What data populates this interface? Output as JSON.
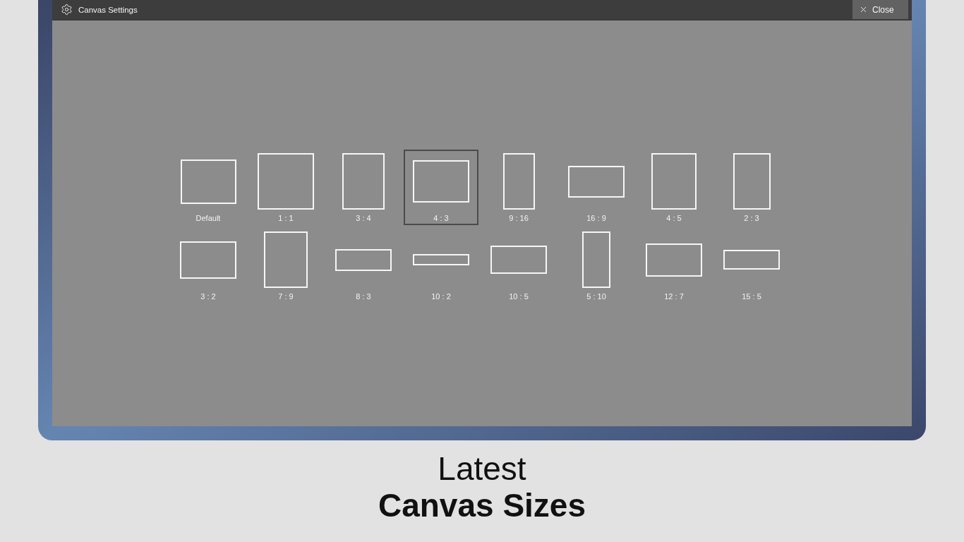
{
  "window": {
    "title": "Canvas Settings",
    "close_button": "Close"
  },
  "presets": [
    {
      "label": "Default",
      "selected": false
    },
    {
      "label": "1 : 1",
      "selected": false
    },
    {
      "label": "3 : 4",
      "selected": false
    },
    {
      "label": "4 : 3",
      "selected": true
    },
    {
      "label": "9 : 16",
      "selected": false
    },
    {
      "label": "16 : 9",
      "selected": false
    },
    {
      "label": "4 : 5",
      "selected": false
    },
    {
      "label": "2 : 3",
      "selected": false
    },
    {
      "label": "3 : 2",
      "selected": false
    },
    {
      "label": "7 : 9",
      "selected": false
    },
    {
      "label": "8 : 3",
      "selected": false
    },
    {
      "label": "10 : 2",
      "selected": false
    },
    {
      "label": "10 : 5",
      "selected": false
    },
    {
      "label": "5 : 10",
      "selected": false
    },
    {
      "label": "12 : 7",
      "selected": false
    },
    {
      "label": "15 : 5",
      "selected": false
    }
  ],
  "caption": {
    "kicker": "Latest",
    "title": "Canvas Sizes"
  }
}
